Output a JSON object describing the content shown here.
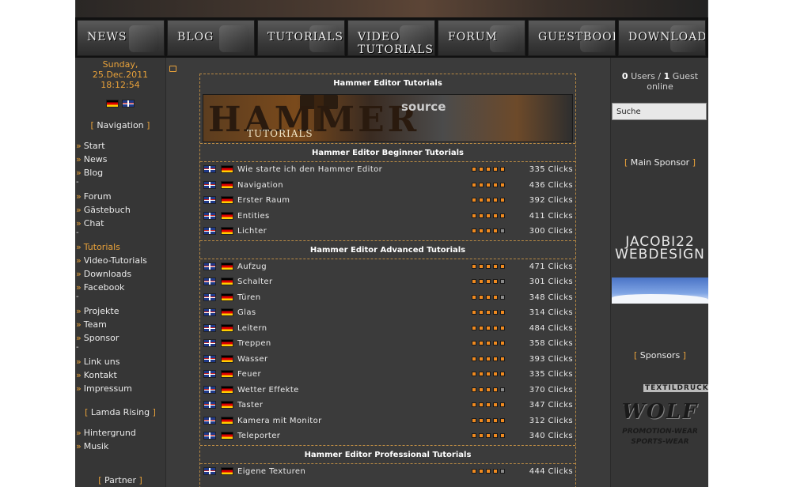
{
  "nav": {
    "buttons": [
      "News",
      "Blog",
      "Tutorials",
      "Video Tutorials",
      "Forum",
      "Guestbook",
      "Downloads"
    ]
  },
  "datetime": {
    "day": "Sunday,",
    "date": "25.Dec.2011",
    "time": "18:12:54"
  },
  "left": {
    "navigation_title": "Navigation",
    "groups": [
      [
        "Start",
        "News",
        "Blog"
      ],
      [
        "Forum",
        "Gästebuch",
        "Chat"
      ],
      [
        "Tutorials",
        "Video-Tutorials",
        "Downloads",
        "Facebook"
      ],
      [
        "Projekte",
        "Team",
        "Sponsor"
      ],
      [
        "Link uns",
        "Kontakt",
        "Impressum"
      ]
    ],
    "active_item": "Tutorials",
    "lamda_title": "Lamda Rising",
    "lamda_items": [
      "Hintergrund",
      "Musik"
    ],
    "partner_title": "Partner"
  },
  "main": {
    "page_title": "Hammer Editor Tutorials",
    "banner": {
      "word": "HAMMER",
      "sub": "TUTORIALS",
      "brand": "source"
    },
    "sections": [
      {
        "title": "Hammer Editor Beginner Tutorials",
        "rows": [
          {
            "title": "Wie starte ich den Hammer Editor",
            "clicks": "335 Clicks",
            "rating": 5
          },
          {
            "title": "Navigation",
            "clicks": "436 Clicks",
            "rating": 5
          },
          {
            "title": "Erster Raum",
            "clicks": "392 Clicks",
            "rating": 5
          },
          {
            "title": "Entities",
            "clicks": "411 Clicks",
            "rating": 5
          },
          {
            "title": "Lichter",
            "clicks": "300 Clicks",
            "rating": 4
          }
        ]
      },
      {
        "title": "Hammer Editor Advanced Tutorials",
        "rows": [
          {
            "title": "Aufzug",
            "clicks": "471 Clicks",
            "rating": 5
          },
          {
            "title": "Schalter",
            "clicks": "301 Clicks",
            "rating": 4
          },
          {
            "title": "Türen",
            "clicks": "348 Clicks",
            "rating": 4
          },
          {
            "title": "Glas",
            "clicks": "314 Clicks",
            "rating": 5
          },
          {
            "title": "Leitern",
            "clicks": "484 Clicks",
            "rating": 5
          },
          {
            "title": "Treppen",
            "clicks": "358 Clicks",
            "rating": 5
          },
          {
            "title": "Wasser",
            "clicks": "393 Clicks",
            "rating": 5
          },
          {
            "title": "Feuer",
            "clicks": "335 Clicks",
            "rating": 5
          },
          {
            "title": "Wetter Effekte",
            "clicks": "370 Clicks",
            "rating": 4
          },
          {
            "title": "Taster",
            "clicks": "347 Clicks",
            "rating": 5
          },
          {
            "title": "Kamera mit Monitor",
            "clicks": "312 Clicks",
            "rating": 5
          },
          {
            "title": "Teleporter",
            "clicks": "340 Clicks",
            "rating": 5
          }
        ]
      },
      {
        "title": "Hammer Editor Professional Tutorials",
        "rows": [
          {
            "title": "Eigene Texturen",
            "clicks": "444 Clicks",
            "rating": 4
          }
        ]
      }
    ]
  },
  "right": {
    "users_count": "0",
    "users_label": "Users /",
    "guests_count": "1",
    "guests_label": "Guest",
    "online_label": "online",
    "search_value": "Suche",
    "main_sponsor_title": "Main Sponsor",
    "jacobi_line1": "JACOBI22",
    "jacobi_line2": "WEBDESIGN",
    "sponsors_title": "Sponsors",
    "wolf_top": "TEXTILDRUCK",
    "wolf_name": "WOLF",
    "wolf_line1": "PROMOTION-WEAR",
    "wolf_line2": "SPORTS-WEAR"
  },
  "colors": {
    "accent": "#e9a23a",
    "background": "#3b3b3b",
    "rating_on": "#f08a1f",
    "rating_off": "#8a8a8a"
  }
}
